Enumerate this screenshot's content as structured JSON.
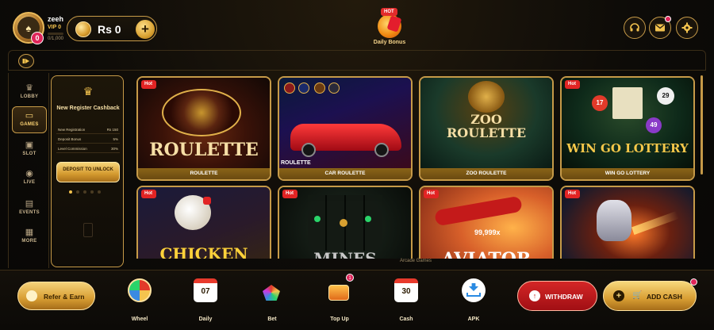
{
  "header": {
    "username": "zeeh",
    "vip": "VIP 0",
    "vip_progress": "0/1,000",
    "avatar_badge": "0",
    "balance": "Rs 0",
    "daily_bonus": {
      "hot": "HOT",
      "label": "Daily Bonus"
    }
  },
  "nav": {
    "items": [
      {
        "label": "LOBBY",
        "icon": "crown-icon"
      },
      {
        "label": "GAMES",
        "icon": "gamepad-icon"
      },
      {
        "label": "SLOT",
        "icon": "slot-icon"
      },
      {
        "label": "LIVE",
        "icon": "live-icon"
      },
      {
        "label": "EVENTS",
        "icon": "calendar-icon"
      },
      {
        "label": "MORE",
        "icon": "grid-icon"
      }
    ],
    "active": "GAMES"
  },
  "promo": {
    "title": "New Register Cashback",
    "rows": [
      {
        "k": "New Registration",
        "v": "Rs 150"
      },
      {
        "k": "Deposit Bonus",
        "v": "5%"
      },
      {
        "k": "Level Commission",
        "v": "30%"
      }
    ],
    "button": "DEPOSIT TO UNLOCK"
  },
  "games": [
    {
      "name": "ROULETTE",
      "art": "ROULETTE",
      "hot": "Hot"
    },
    {
      "name": "CAR ROULETTE",
      "art": "ROULETTE",
      "hot": ""
    },
    {
      "name": "ZOO ROULETTE",
      "art": "ZOO ROULETTE",
      "hot": ""
    },
    {
      "name": "WIN GO LOTTERY",
      "art": "WIN GO LOTTERY",
      "hot": "Hot"
    },
    {
      "name": "",
      "art": "CHICKEN",
      "hot": "Hot"
    },
    {
      "name": "",
      "art": "MINES",
      "hot": "Hot"
    },
    {
      "name": "",
      "art": "AVIATOR",
      "hot": "Hot",
      "multiplier": "99,999x"
    },
    {
      "name": "",
      "art": "",
      "hot": "Hot"
    }
  ],
  "grid_footer": "Arcade Games",
  "bottom": {
    "refer": "Refer & Earn",
    "items": [
      {
        "label": "Wheel"
      },
      {
        "label": "Daily",
        "value": "07"
      },
      {
        "label": "Bet"
      },
      {
        "label": "Top Up",
        "badge": "1"
      },
      {
        "label": "Cash",
        "value": "30"
      },
      {
        "label": "APK"
      }
    ],
    "withdraw": "WITHDRAW",
    "add_cash": "ADD CASH"
  }
}
